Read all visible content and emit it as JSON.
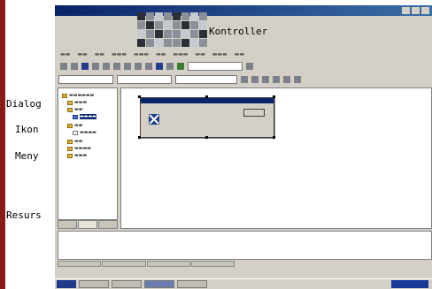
{
  "annotations": {
    "kontroller": "Kontroller",
    "dialog": "Dialog",
    "ikon": "Ikon",
    "meny": "Meny",
    "resurs": "Resurs"
  },
  "screenshot": {
    "title_bar": {
      "text": "",
      "controls": [
        "minimize-icon",
        "maximize-icon",
        "close-icon"
      ]
    },
    "menu_bar": {
      "items": []
    },
    "solution_panel": {
      "tree": []
    },
    "editor": {
      "dialog_preview": {
        "caption": "",
        "text_line_1": "",
        "text_line_2": "",
        "ok_label": ""
      }
    },
    "output": {
      "header": "",
      "line": ""
    },
    "taskbar": {
      "start_label": ""
    }
  },
  "colors": {
    "edge_bar": "#8b1a1f",
    "title_bar": "#0a246a",
    "window_bg": "#d4d0c8",
    "selection": "#0a246a"
  }
}
